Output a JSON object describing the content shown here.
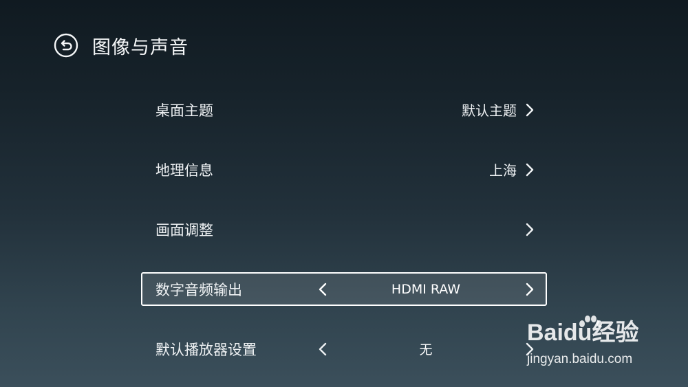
{
  "header": {
    "title": "图像与声音",
    "back_icon": "back-arrow-circle-icon"
  },
  "menu": {
    "items": [
      {
        "label": "桌面主题",
        "value": "默认主题"
      },
      {
        "label": "地理信息",
        "value": "上海"
      },
      {
        "label": "画面调整",
        "value": ""
      },
      {
        "label": "数字音频输出",
        "value": "HDMI RAW"
      },
      {
        "label": "默认播放器设置",
        "value": "无"
      }
    ],
    "focused_index": 3
  },
  "watermark": {
    "logo": "Baidu经验",
    "url": "jingyan.baidu.com"
  },
  "colors": {
    "text": "#f2f4f5",
    "focus_border": "#ffffff",
    "background_top": "#101a21",
    "background_bottom": "#3b4f5b"
  }
}
